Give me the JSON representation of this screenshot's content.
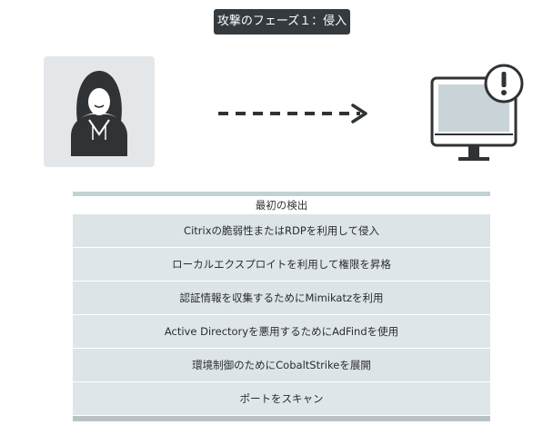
{
  "header": {
    "title": "攻撃のフェーズ１：侵入"
  },
  "diagram": {
    "attacker_icon": "hooded-attacker-icon",
    "arrow_icon": "dashed-arrow-right-icon",
    "target_icon": "monitor-alert-icon"
  },
  "table": {
    "heading": "最初の検出",
    "rows": [
      "Citrixの脆弱性またはRDPを利用して侵入",
      "ローカルエクスプロイトを利用して権限を昇格",
      "認証情報を収集するためにMimikatzを利用",
      "Active Directoryを悪用するためにAdFindを使用",
      "環境制御のためにCobaltStrikeを展開",
      "ポートをスキャン"
    ]
  },
  "colors": {
    "title_bg": "#343a3d",
    "card_bg": "#e4e7ea",
    "row_bg": "#dfe6e9",
    "accent_bar": "#c2d1d4",
    "icon_dark": "#2f3336"
  }
}
